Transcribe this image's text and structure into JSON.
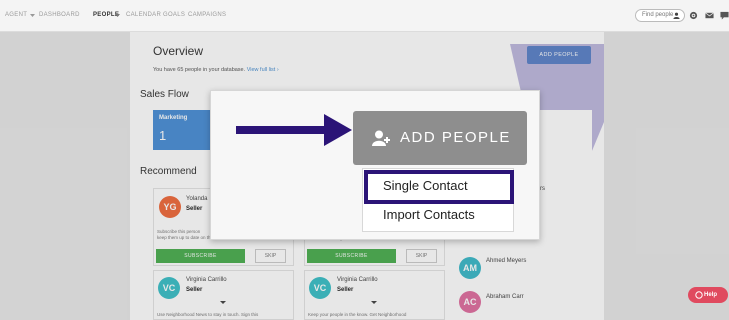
{
  "navbar": {
    "agent": "AGENT",
    "dashboard": "DASHBOARD",
    "people": "PEOPLE",
    "calendar": "CALENDAR",
    "goals": "GOALS",
    "campaigns": "CAMPAIGNS",
    "search_placeholder": "Find people",
    "icons": [
      "user-icon",
      "gear-icon",
      "mail-icon",
      "chat-icon"
    ]
  },
  "overview": {
    "title": "Overview",
    "subtitle": "You have 65 people in your database.",
    "view_link": "View full list ›"
  },
  "header_add_button": "ADD PEOPLE",
  "sales_flow": {
    "title": "Sales Flow",
    "pipeline_label": "Marketing",
    "pipeline_count": "1"
  },
  "recommendations": {
    "title": "Recommend",
    "cards": [
      {
        "initials": "YG",
        "name": "Yolanda",
        "role": "Seller",
        "text1": "Subscribe this person",
        "text2": "keep them up to date on the housing market! ",
        "subscribe": "SUBSCRIBE",
        "skip": "SKIP",
        "color": "#f06a3c"
      },
      {
        "initials": "",
        "name": "",
        "role": "",
        "text1": "",
        "text2": "latest comparable sales",
        "subscribe": "SUBSCRIBE",
        "skip": "SKIP",
        "color": "#f06a3c"
      },
      {
        "initials": "VC",
        "name": "Virginia Carrillo",
        "role": "Seller",
        "text1": "Use Neighborhood News to stay in touch. Sign this",
        "color": "#3cc0c8"
      },
      {
        "initials": "VC",
        "name": "Virginia Carrillo",
        "role": "Seller",
        "text1": "Keep your people in the know. Get Neighborhood",
        "color": "#3cc0c8"
      }
    ]
  },
  "people": [
    {
      "initials": "AM",
      "name": "Ahmed Meyers",
      "color": "#3cb9c9"
    },
    {
      "initials": "AC",
      "name": "Abraham Carr",
      "color": "#e06fa0"
    }
  ],
  "people_partial": "rs",
  "modal": {
    "add_button": "ADD PEOPLE",
    "menu": [
      "Single Contact",
      "Import Contacts"
    ]
  },
  "help": "Help",
  "colors": {
    "primary": "#4b8fd6",
    "accent_purple": "#2b1477",
    "subscribe_green": "#4caf50",
    "help_red": "#e04a5f"
  }
}
